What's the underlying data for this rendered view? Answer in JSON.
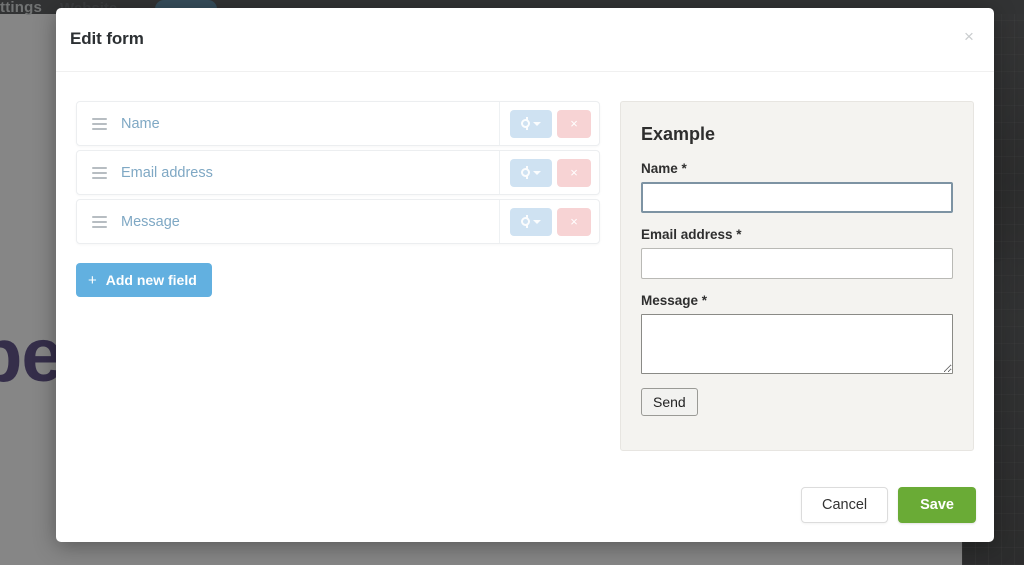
{
  "background": {
    "nav_label": "ttings",
    "brand_text": "Website",
    "hero_text": "be",
    "scrim_color": "#3c3c3c"
  },
  "modal": {
    "title": "Edit form",
    "close_label": "×",
    "fields": [
      {
        "label": "Name",
        "settings_label": "",
        "remove_label": "×"
      },
      {
        "label": "Email address",
        "settings_label": "",
        "remove_label": "×"
      },
      {
        "label": "Message",
        "settings_label": "",
        "remove_label": "×"
      }
    ],
    "add_field": {
      "icon": "+",
      "label": "Add new field"
    },
    "example": {
      "title": "Example",
      "fields": [
        {
          "label": "Name *",
          "type": "text",
          "value": "",
          "focused": true
        },
        {
          "label": "Email address *",
          "type": "text",
          "value": "",
          "focused": false
        },
        {
          "label": "Message *",
          "type": "textarea",
          "value": "",
          "focused": false
        }
      ],
      "submit_label": "Send"
    },
    "footer": {
      "cancel_label": "Cancel",
      "save_label": "Save"
    }
  },
  "colors": {
    "accent_blue": "#62b0e0",
    "save_green": "#6aab36",
    "field_label_blue": "#7fa8c4",
    "settings_btn": "#cfe2f2",
    "remove_btn": "#f7d3d4",
    "panel_bg": "#f4f3f0"
  }
}
